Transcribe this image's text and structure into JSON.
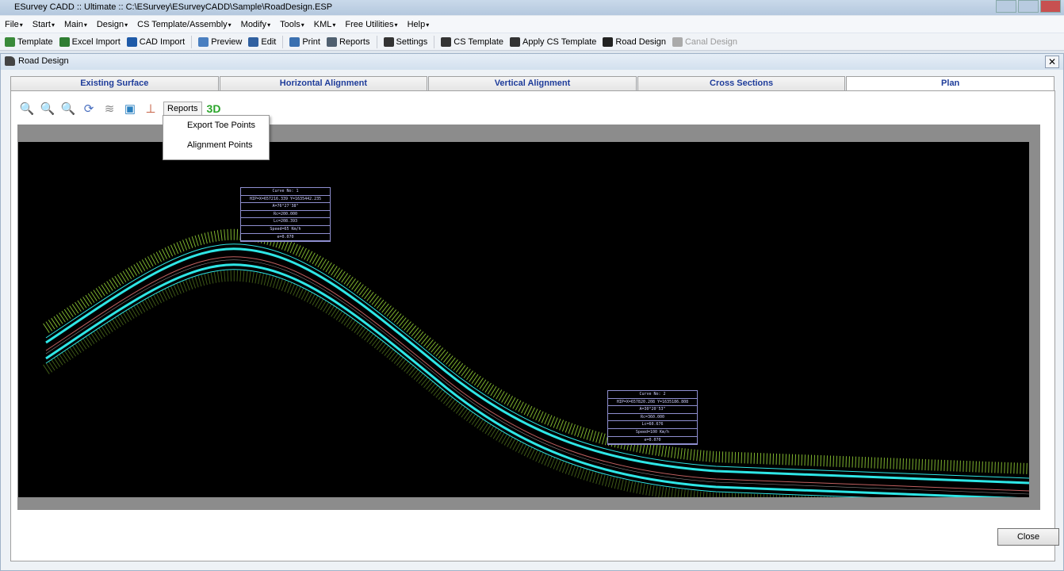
{
  "app_title": "ESurvey CADD :: Ultimate :: C:\\ESurvey\\ESurveyCADD\\Sample\\RoadDesign.ESP",
  "menu": [
    "File",
    "Start",
    "Main",
    "Design",
    "CS Template/Assembly",
    "Modify",
    "Tools",
    "KML",
    "Free Utilities",
    "Help"
  ],
  "toolbar": [
    {
      "label": "Template",
      "icon": "template-icon",
      "color": "#3a8a3a"
    },
    {
      "label": "Excel Import",
      "icon": "excel-icon",
      "color": "#2e7d32"
    },
    {
      "label": "CAD Import",
      "icon": "cad-import-icon",
      "color": "#1e5aa8"
    },
    {
      "label": "Preview",
      "icon": "preview-icon",
      "color": "#4a7fc0"
    },
    {
      "label": "Edit",
      "icon": "edit-icon",
      "color": "#3060a0"
    },
    {
      "label": "Print",
      "icon": "print-icon",
      "color": "#3a70b0"
    },
    {
      "label": "Reports",
      "icon": "reports-icon",
      "color": "#506070"
    },
    {
      "label": "Settings",
      "icon": "settings-icon",
      "color": "#333"
    },
    {
      "label": "CS Template",
      "icon": "cs-template-icon",
      "color": "#333"
    },
    {
      "label": "Apply CS Template",
      "icon": "apply-cs-template-icon",
      "color": "#333"
    },
    {
      "label": "Road Design",
      "icon": "road-design-icon",
      "color": "#222"
    },
    {
      "label": "Canal Design",
      "icon": "canal-design-icon",
      "color": "#aaa",
      "disabled": true
    }
  ],
  "window": {
    "title": "Road Design",
    "close_label": "Close"
  },
  "tabs": [
    "Existing Surface",
    "Horizontal Alignment",
    "Vertical Alignment",
    "Cross Sections",
    "Plan"
  ],
  "active_tab": "Plan",
  "plan_toolbar": {
    "reports_label": "Reports",
    "three_d_label": "3D"
  },
  "reports_menu": [
    "Export Toe Points",
    "Alignment Points"
  ],
  "curves": [
    {
      "rows": [
        "Curve No: 1",
        "HIP=X=657216.339 Y=1635442.235",
        "A=76°27'38\"",
        "Rc=200.000",
        "Lc=208.393",
        "Speed=65 Km/h",
        "e=0.070"
      ]
    },
    {
      "rows": [
        "Curve No: 2",
        "HIP=X=657820.208 Y=1635186.808",
        "A=30°20'53\"",
        "Rc=360.000",
        "Lc=60.676",
        "Speed=100 Km/h",
        "e=0.070"
      ]
    }
  ],
  "colors": {
    "alignment": "#2ee6e6",
    "toe": "#9ee03a",
    "centerline": "#c06060",
    "table_border": "#8f8fd0"
  }
}
